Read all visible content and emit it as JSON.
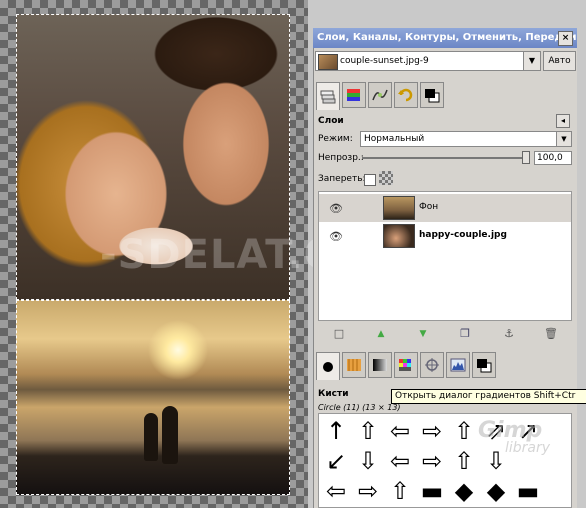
{
  "window": {
    "title": "Слои, Каналы, Контуры, Отменить, Передний",
    "close_glyph": "×"
  },
  "image_selector": {
    "name": "couple-sunset.jpg-9",
    "auto_label": "Авто"
  },
  "tabs_top": [
    {
      "name": "layers-tab",
      "icon": "layers-icon"
    },
    {
      "name": "channels-tab",
      "icon": "channels-icon"
    },
    {
      "name": "paths-tab",
      "icon": "paths-icon"
    },
    {
      "name": "undo-tab",
      "icon": "undo-icon"
    },
    {
      "name": "colors-tab",
      "icon": "fg-bg-color-icon"
    }
  ],
  "layers_panel": {
    "title": "Слои",
    "mode_label": "Режим:",
    "mode_value": "Нормальный",
    "opacity_label": "Непрозр.:",
    "opacity_value": "100,0",
    "opacity_fraction": 1.0,
    "lock_label": "Запереть:",
    "layers": [
      {
        "name": "Фон",
        "selected": true
      },
      {
        "name": "happy-couple.jpg",
        "selected": false
      }
    ]
  },
  "layer_buttons": [
    {
      "name": "new-layer-button",
      "glyph": "□"
    },
    {
      "name": "raise-layer-button",
      "glyph": "▲"
    },
    {
      "name": "lower-layer-button",
      "glyph": "▼"
    },
    {
      "name": "duplicate-layer-button",
      "glyph": "❐"
    },
    {
      "name": "anchor-layer-button",
      "glyph": "⚓"
    },
    {
      "name": "delete-layer-button",
      "glyph": "🗑"
    }
  ],
  "tabs_bottom": [
    {
      "name": "brushes-tab",
      "icon": "brush-icon"
    },
    {
      "name": "patterns-tab",
      "icon": "pattern-icon"
    },
    {
      "name": "gradients-tab",
      "icon": "gradient-icon"
    },
    {
      "name": "palettes-tab",
      "icon": "palette-icon"
    },
    {
      "name": "fonts-tab",
      "icon": "font-icon"
    },
    {
      "name": "histogram-tab",
      "icon": "histogram-icon"
    },
    {
      "name": "fg-bg-tab",
      "icon": "fg-bg-color-icon"
    }
  ],
  "brushes_panel": {
    "title": "Кисти",
    "brush_info": "Circle (11) (13 × 13)",
    "tooltip": "Открыть диалог градиентов  Shift+Ctr",
    "brushes": [
      "↑",
      "⇧",
      "⇦",
      "⇨",
      "⇧",
      "⇗",
      "↗",
      "↙",
      "⇩",
      "⇦",
      "⇨",
      "⇧",
      "⇩",
      "⇦",
      "⇨",
      "⇧",
      "▬",
      "◆",
      "◆",
      "▬"
    ]
  },
  "watermarks": {
    "center": "-SDELAT.ORG",
    "corner_big": "Gimp",
    "corner_small": "library"
  }
}
